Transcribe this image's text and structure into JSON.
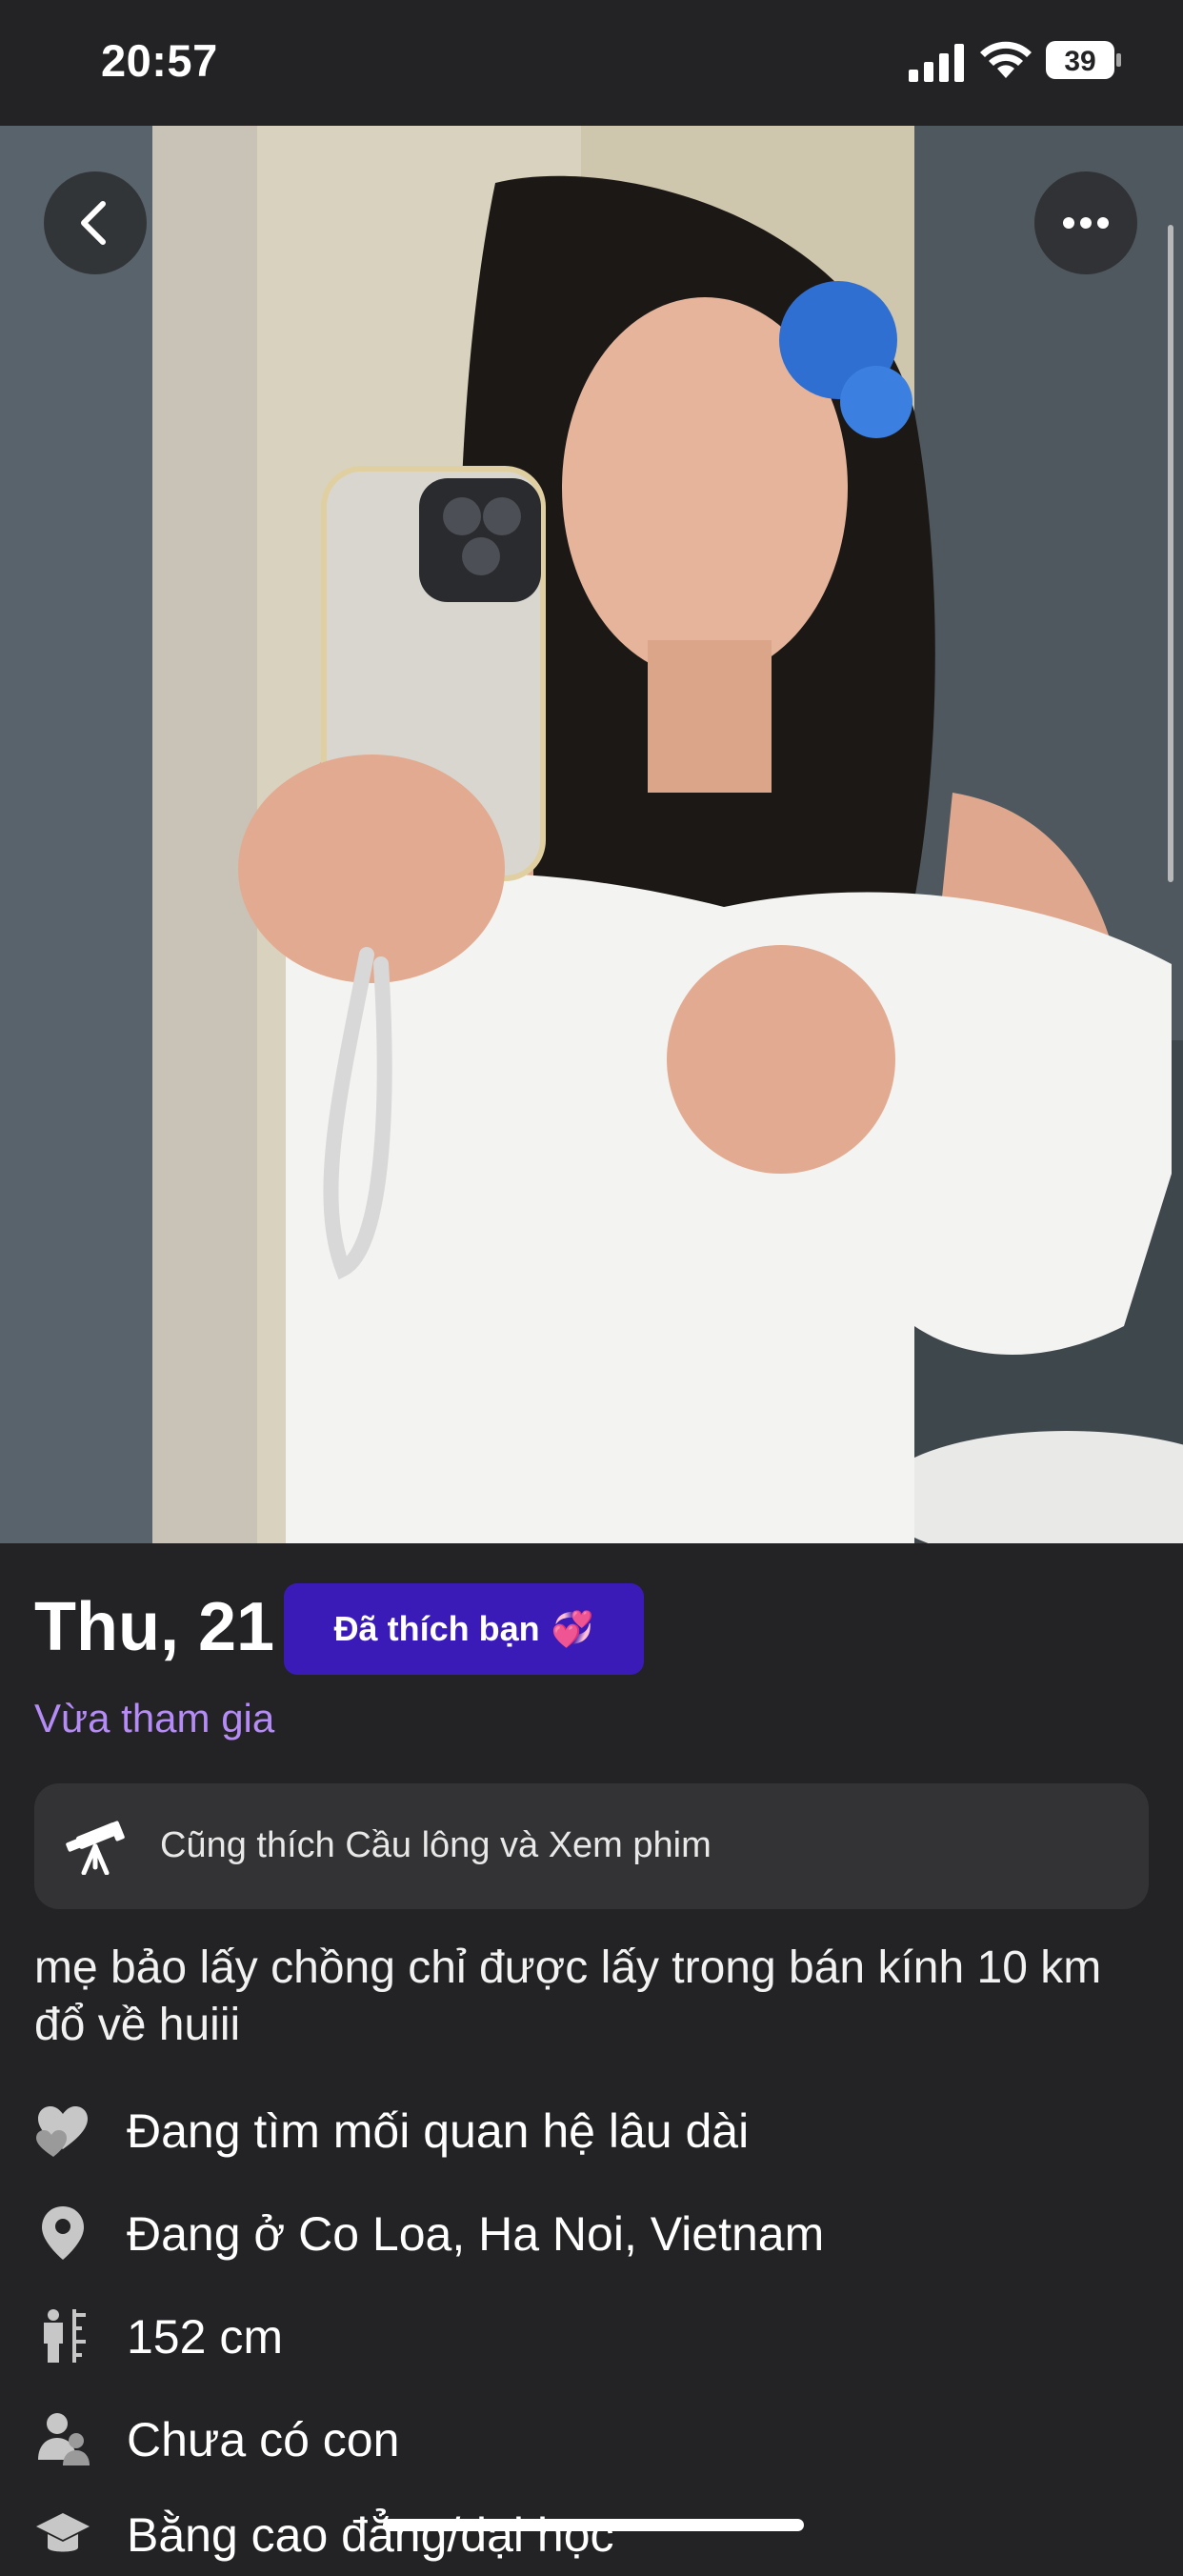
{
  "status_bar": {
    "time": "20:57",
    "battery": "39"
  },
  "profile": {
    "name_age": "Thu, 21",
    "liked_badge": "Đã thích bạn",
    "liked_emoji": "💞",
    "joined_status": "Vừa tham gia",
    "common_interests": "Cũng thích Cầu lông và Xem phim",
    "bio": "mẹ bảo lấy chồng chỉ được lấy trong bán kính 10 km đổ về huiii",
    "attributes": [
      {
        "icon": "hearts-icon",
        "label": "Đang tìm mối quan hệ lâu dài"
      },
      {
        "icon": "location-pin-icon",
        "label": "Đang ở Co Loa, Ha Noi, Vietnam"
      },
      {
        "icon": "height-icon",
        "label": "152 cm"
      },
      {
        "icon": "children-icon",
        "label": "Chưa có con"
      },
      {
        "icon": "education-icon",
        "label": "Bằng cao đẳng/đại học"
      }
    ]
  },
  "colors": {
    "background": "#232325",
    "accent_badge": "#3b1bb8",
    "joined_text": "#b58cf6",
    "box": "#333335"
  }
}
